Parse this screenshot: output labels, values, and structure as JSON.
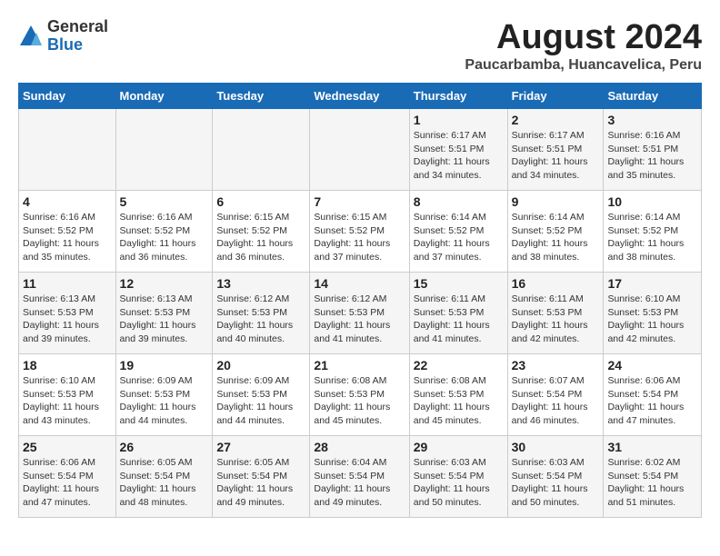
{
  "header": {
    "logo_general": "General",
    "logo_blue": "Blue",
    "month_year": "August 2024",
    "location": "Paucarbamba, Huancavelica, Peru"
  },
  "calendar": {
    "days_of_week": [
      "Sunday",
      "Monday",
      "Tuesday",
      "Wednesday",
      "Thursday",
      "Friday",
      "Saturday"
    ],
    "weeks": [
      [
        {
          "day": "",
          "info": ""
        },
        {
          "day": "",
          "info": ""
        },
        {
          "day": "",
          "info": ""
        },
        {
          "day": "",
          "info": ""
        },
        {
          "day": "1",
          "info": "Sunrise: 6:17 AM\nSunset: 5:51 PM\nDaylight: 11 hours and 34 minutes."
        },
        {
          "day": "2",
          "info": "Sunrise: 6:17 AM\nSunset: 5:51 PM\nDaylight: 11 hours and 34 minutes."
        },
        {
          "day": "3",
          "info": "Sunrise: 6:16 AM\nSunset: 5:51 PM\nDaylight: 11 hours and 35 minutes."
        }
      ],
      [
        {
          "day": "4",
          "info": "Sunrise: 6:16 AM\nSunset: 5:52 PM\nDaylight: 11 hours and 35 minutes."
        },
        {
          "day": "5",
          "info": "Sunrise: 6:16 AM\nSunset: 5:52 PM\nDaylight: 11 hours and 36 minutes."
        },
        {
          "day": "6",
          "info": "Sunrise: 6:15 AM\nSunset: 5:52 PM\nDaylight: 11 hours and 36 minutes."
        },
        {
          "day": "7",
          "info": "Sunrise: 6:15 AM\nSunset: 5:52 PM\nDaylight: 11 hours and 37 minutes."
        },
        {
          "day": "8",
          "info": "Sunrise: 6:14 AM\nSunset: 5:52 PM\nDaylight: 11 hours and 37 minutes."
        },
        {
          "day": "9",
          "info": "Sunrise: 6:14 AM\nSunset: 5:52 PM\nDaylight: 11 hours and 38 minutes."
        },
        {
          "day": "10",
          "info": "Sunrise: 6:14 AM\nSunset: 5:52 PM\nDaylight: 11 hours and 38 minutes."
        }
      ],
      [
        {
          "day": "11",
          "info": "Sunrise: 6:13 AM\nSunset: 5:53 PM\nDaylight: 11 hours and 39 minutes."
        },
        {
          "day": "12",
          "info": "Sunrise: 6:13 AM\nSunset: 5:53 PM\nDaylight: 11 hours and 39 minutes."
        },
        {
          "day": "13",
          "info": "Sunrise: 6:12 AM\nSunset: 5:53 PM\nDaylight: 11 hours and 40 minutes."
        },
        {
          "day": "14",
          "info": "Sunrise: 6:12 AM\nSunset: 5:53 PM\nDaylight: 11 hours and 41 minutes."
        },
        {
          "day": "15",
          "info": "Sunrise: 6:11 AM\nSunset: 5:53 PM\nDaylight: 11 hours and 41 minutes."
        },
        {
          "day": "16",
          "info": "Sunrise: 6:11 AM\nSunset: 5:53 PM\nDaylight: 11 hours and 42 minutes."
        },
        {
          "day": "17",
          "info": "Sunrise: 6:10 AM\nSunset: 5:53 PM\nDaylight: 11 hours and 42 minutes."
        }
      ],
      [
        {
          "day": "18",
          "info": "Sunrise: 6:10 AM\nSunset: 5:53 PM\nDaylight: 11 hours and 43 minutes."
        },
        {
          "day": "19",
          "info": "Sunrise: 6:09 AM\nSunset: 5:53 PM\nDaylight: 11 hours and 44 minutes."
        },
        {
          "day": "20",
          "info": "Sunrise: 6:09 AM\nSunset: 5:53 PM\nDaylight: 11 hours and 44 minutes."
        },
        {
          "day": "21",
          "info": "Sunrise: 6:08 AM\nSunset: 5:53 PM\nDaylight: 11 hours and 45 minutes."
        },
        {
          "day": "22",
          "info": "Sunrise: 6:08 AM\nSunset: 5:53 PM\nDaylight: 11 hours and 45 minutes."
        },
        {
          "day": "23",
          "info": "Sunrise: 6:07 AM\nSunset: 5:54 PM\nDaylight: 11 hours and 46 minutes."
        },
        {
          "day": "24",
          "info": "Sunrise: 6:06 AM\nSunset: 5:54 PM\nDaylight: 11 hours and 47 minutes."
        }
      ],
      [
        {
          "day": "25",
          "info": "Sunrise: 6:06 AM\nSunset: 5:54 PM\nDaylight: 11 hours and 47 minutes."
        },
        {
          "day": "26",
          "info": "Sunrise: 6:05 AM\nSunset: 5:54 PM\nDaylight: 11 hours and 48 minutes."
        },
        {
          "day": "27",
          "info": "Sunrise: 6:05 AM\nSunset: 5:54 PM\nDaylight: 11 hours and 49 minutes."
        },
        {
          "day": "28",
          "info": "Sunrise: 6:04 AM\nSunset: 5:54 PM\nDaylight: 11 hours and 49 minutes."
        },
        {
          "day": "29",
          "info": "Sunrise: 6:03 AM\nSunset: 5:54 PM\nDaylight: 11 hours and 50 minutes."
        },
        {
          "day": "30",
          "info": "Sunrise: 6:03 AM\nSunset: 5:54 PM\nDaylight: 11 hours and 50 minutes."
        },
        {
          "day": "31",
          "info": "Sunrise: 6:02 AM\nSunset: 5:54 PM\nDaylight: 11 hours and 51 minutes."
        }
      ]
    ]
  }
}
